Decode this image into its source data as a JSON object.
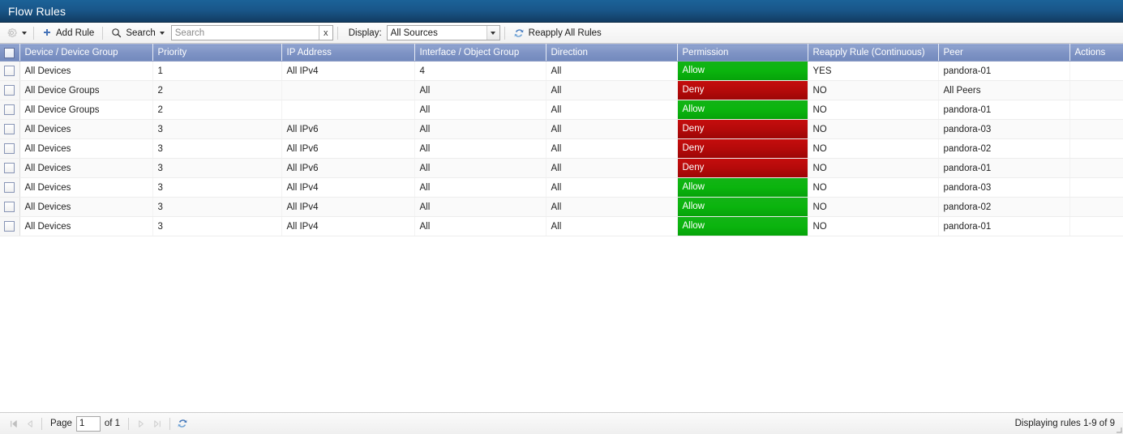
{
  "window": {
    "title": "Flow Rules"
  },
  "toolbar": {
    "gear_icon": "gear-icon",
    "gear_caret_icon": "chevron-down-icon",
    "add_rule_label": "Add Rule",
    "add_rule_icon": "plus-icon",
    "search_menu_label": "Search",
    "search_menu_icon": "magnifier-icon",
    "search_menu_caret_icon": "chevron-down-icon",
    "search_value": "",
    "search_placeholder": "Search",
    "search_clear_label": "x",
    "display_label": "Display:",
    "display_value": "All Sources",
    "display_caret_icon": "chevron-down-icon",
    "reapply_label": "Reapply All Rules",
    "reapply_icon": "refresh-icon"
  },
  "table": {
    "select_all_name": "select-all-checkbox",
    "columns": [
      {
        "label": "",
        "key": "checkbox",
        "width": 24
      },
      {
        "label": "Device / Device Group",
        "key": "device",
        "width": 164
      },
      {
        "label": "Priority",
        "key": "priority",
        "width": 159
      },
      {
        "label": "IP Address",
        "key": "ip",
        "width": 164
      },
      {
        "label": "Interface / Object Group",
        "key": "interface",
        "width": 162
      },
      {
        "label": "Direction",
        "key": "direction",
        "width": 162
      },
      {
        "label": "Permission",
        "key": "permission",
        "width": 161
      },
      {
        "label": "Reapply Rule (Continuous)",
        "key": "reapply",
        "width": 161
      },
      {
        "label": "Peer",
        "key": "peer",
        "width": 162
      },
      {
        "label": "Actions",
        "key": "actions",
        "width": 66
      }
    ],
    "rows": [
      {
        "device": "All Devices",
        "priority": "1",
        "ip": "All IPv4",
        "interface": "4",
        "direction": "All",
        "permission": "Allow",
        "reapply": "YES",
        "peer": "pandora-01",
        "actions": ""
      },
      {
        "device": "All Device Groups",
        "priority": "2",
        "ip": "",
        "interface": "All",
        "direction": "All",
        "permission": "Deny",
        "reapply": "NO",
        "peer": "All Peers",
        "actions": ""
      },
      {
        "device": "All Device Groups",
        "priority": "2",
        "ip": "",
        "interface": "All",
        "direction": "All",
        "permission": "Allow",
        "reapply": "NO",
        "peer": "pandora-01",
        "actions": ""
      },
      {
        "device": "All Devices",
        "priority": "3",
        "ip": "All IPv6",
        "interface": "All",
        "direction": "All",
        "permission": "Deny",
        "reapply": "NO",
        "peer": "pandora-03",
        "actions": ""
      },
      {
        "device": "All Devices",
        "priority": "3",
        "ip": "All IPv6",
        "interface": "All",
        "direction": "All",
        "permission": "Deny",
        "reapply": "NO",
        "peer": "pandora-02",
        "actions": ""
      },
      {
        "device": "All Devices",
        "priority": "3",
        "ip": "All IPv6",
        "interface": "All",
        "direction": "All",
        "permission": "Deny",
        "reapply": "NO",
        "peer": "pandora-01",
        "actions": ""
      },
      {
        "device": "All Devices",
        "priority": "3",
        "ip": "All IPv4",
        "interface": "All",
        "direction": "All",
        "permission": "Allow",
        "reapply": "NO",
        "peer": "pandora-03",
        "actions": ""
      },
      {
        "device": "All Devices",
        "priority": "3",
        "ip": "All IPv4",
        "interface": "All",
        "direction": "All",
        "permission": "Allow",
        "reapply": "NO",
        "peer": "pandora-02",
        "actions": ""
      },
      {
        "device": "All Devices",
        "priority": "3",
        "ip": "All IPv4",
        "interface": "All",
        "direction": "All",
        "permission": "Allow",
        "reapply": "NO",
        "peer": "pandora-01",
        "actions": ""
      }
    ]
  },
  "pager": {
    "first_icon": "first-page-icon",
    "prev_icon": "prev-page-icon",
    "page_label": "Page",
    "page_value": "1",
    "of_label": "of 1",
    "next_icon": "next-page-icon",
    "last_icon": "last-page-icon",
    "refresh_icon": "refresh-icon",
    "status": "Displaying rules 1-9 of 9"
  },
  "colors": {
    "title_bar_top": "#1b6298",
    "title_bar_bottom": "#123c62",
    "header_row": "#7e93c4",
    "allow_green": "#0bb40e",
    "deny_red": "#b50a0a",
    "accent_blue": "#3a6ea5"
  }
}
